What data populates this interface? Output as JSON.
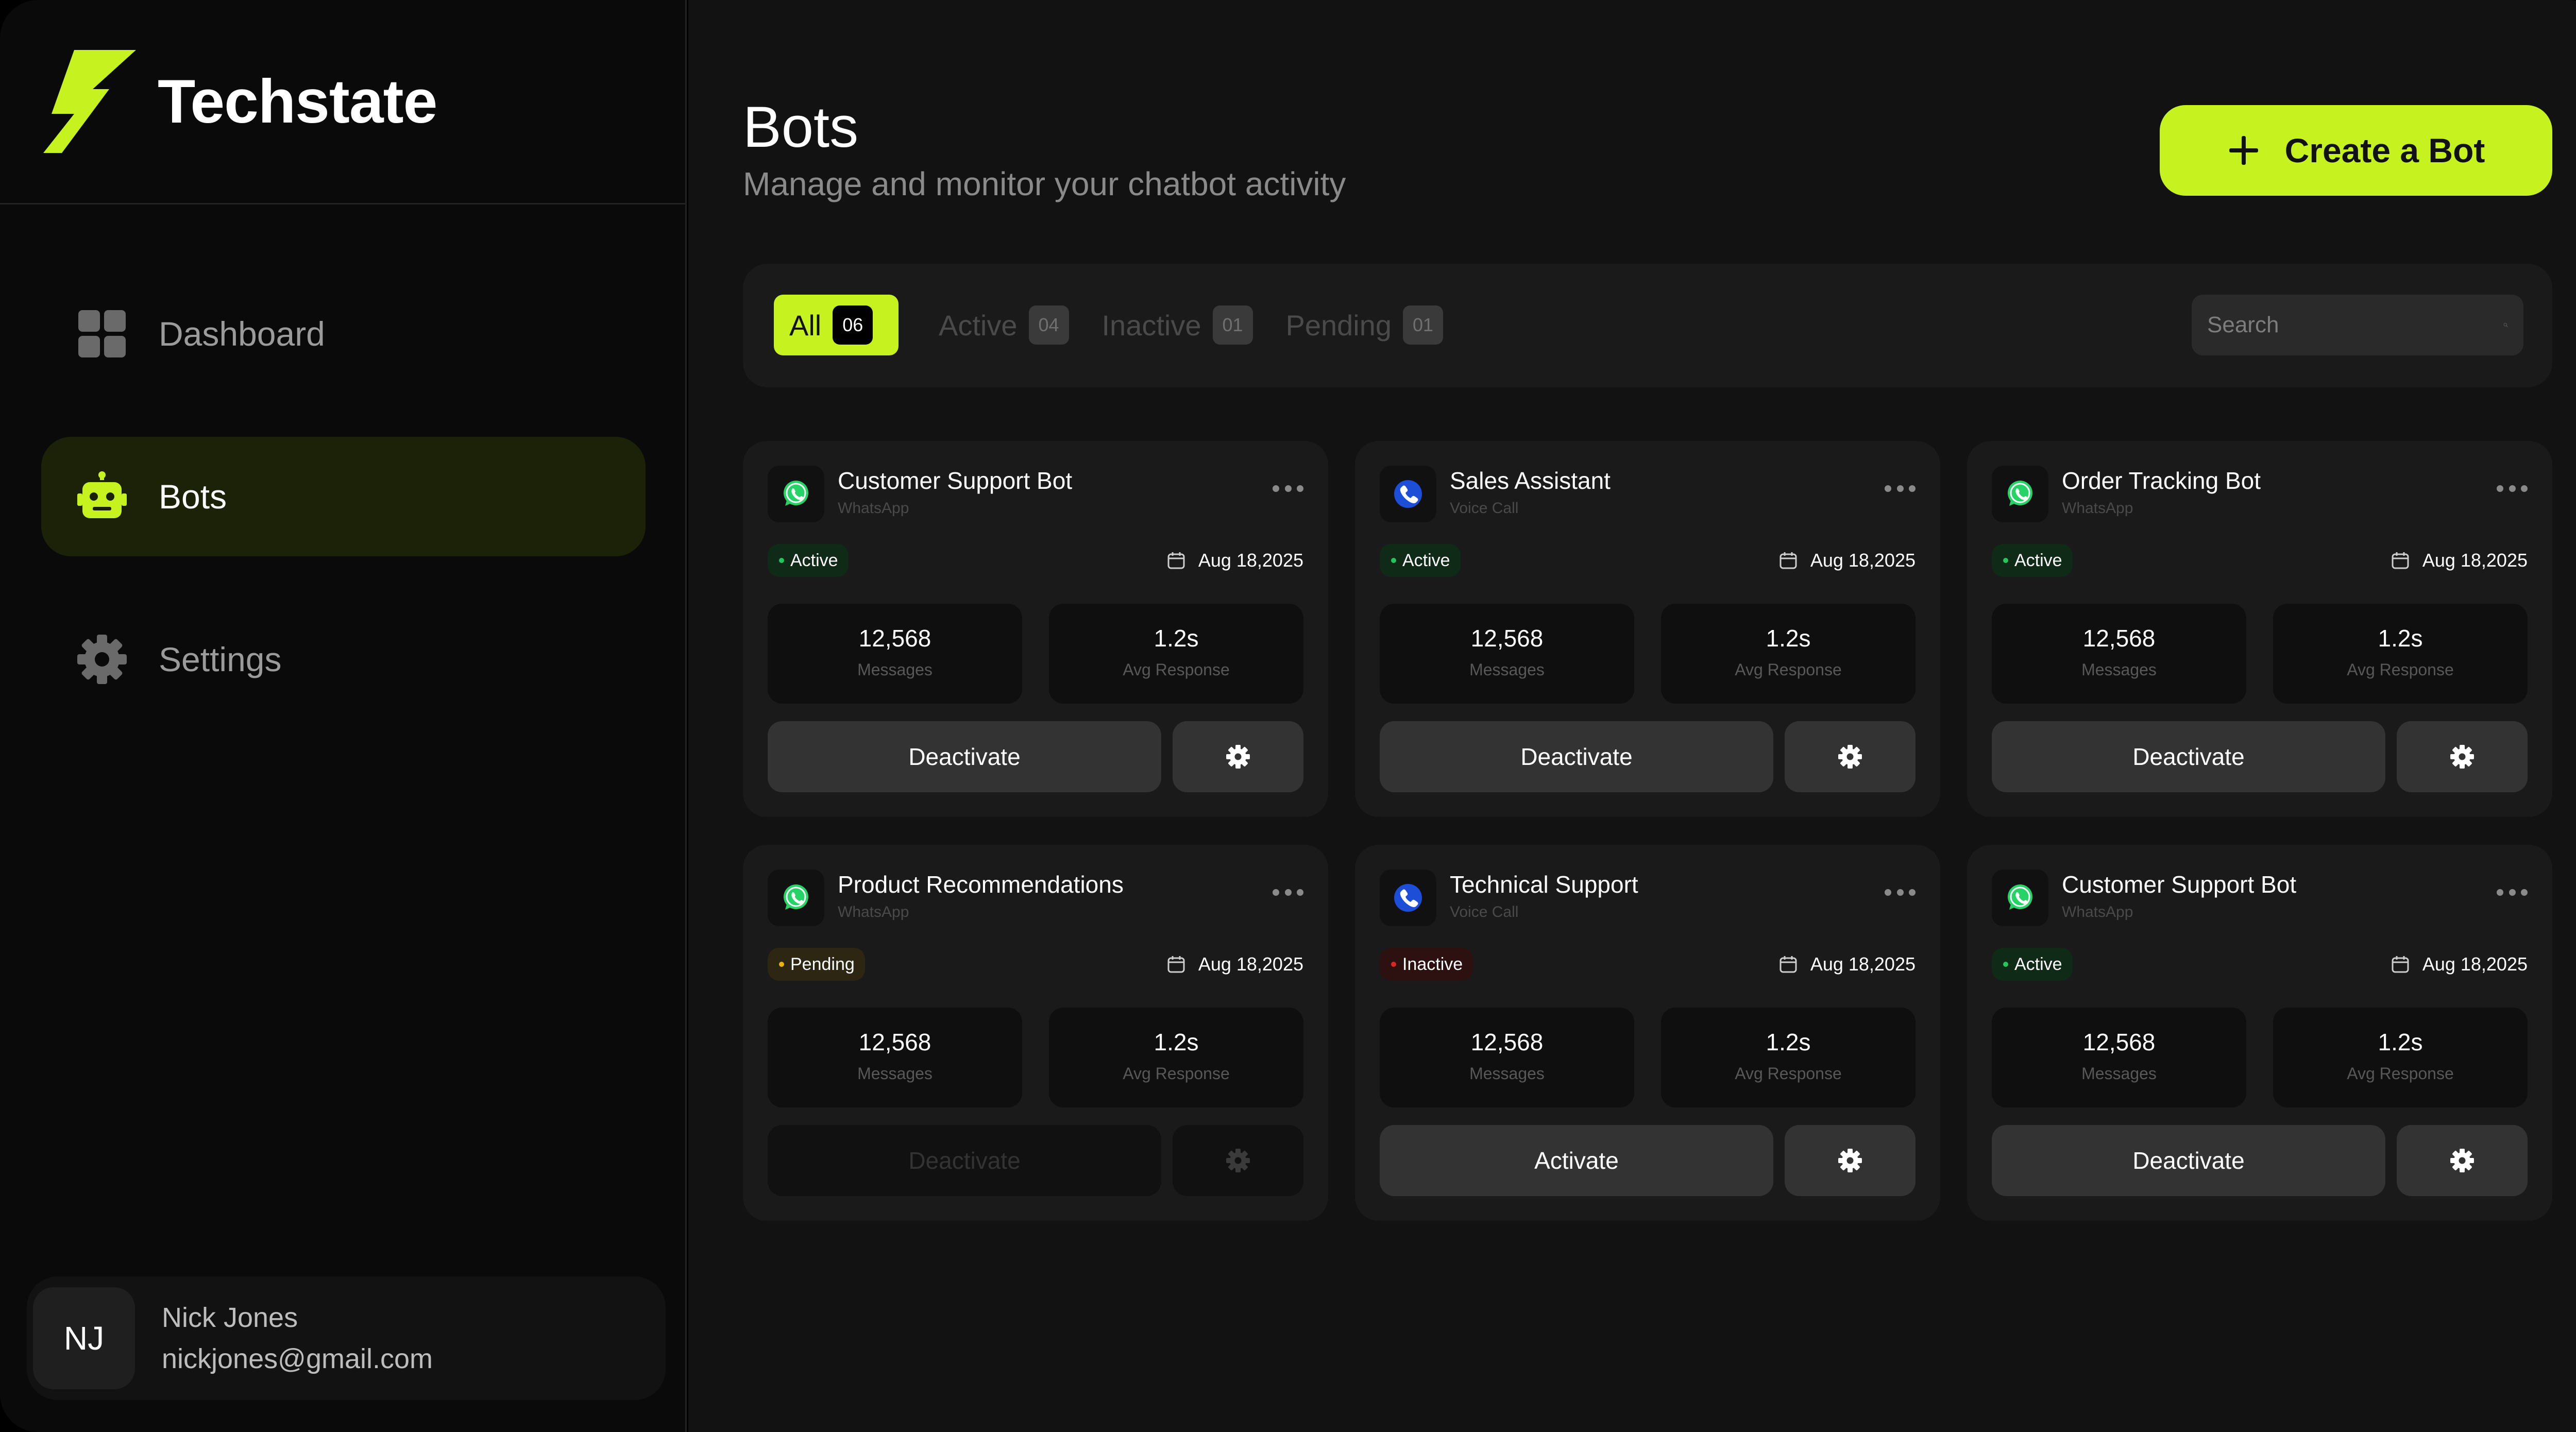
{
  "brand": {
    "name": "Techstate",
    "accent": "#c6f21f"
  },
  "sidebar": {
    "items": [
      {
        "label": "Dashboard",
        "icon": "dashboard-grid-icon",
        "active": false
      },
      {
        "label": "Bots",
        "icon": "robot-icon",
        "active": true
      },
      {
        "label": "Settings",
        "icon": "gear-icon",
        "active": false
      }
    ],
    "user": {
      "initials": "NJ",
      "name": "Nick Jones",
      "email": "nickjones@gmail.com"
    }
  },
  "header": {
    "title": "Bots",
    "subtitle": "Manage and monitor your chatbot activity",
    "create_button": "Create a Bot"
  },
  "filters": {
    "tabs": [
      {
        "label": "All",
        "count": "06",
        "active": true
      },
      {
        "label": "Active",
        "count": "04",
        "active": false
      },
      {
        "label": "Inactive",
        "count": "01",
        "active": false
      },
      {
        "label": "Pending",
        "count": "01",
        "active": false
      }
    ],
    "search_placeholder": "Search"
  },
  "bots": [
    {
      "name": "Customer Support Bot",
      "channel": "WhatsApp",
      "channel_icon": "whatsapp-icon",
      "status": "Active",
      "date": "Aug 18,2025",
      "messages": "12,568",
      "messages_label": "Messages",
      "avg_response": "1.2s",
      "avg_response_label": "Avg Response",
      "action": "Deactivate",
      "disabled": false
    },
    {
      "name": "Sales Assistant",
      "channel": "Voice Call",
      "channel_icon": "phone-icon",
      "status": "Active",
      "date": "Aug 18,2025",
      "messages": "12,568",
      "messages_label": "Messages",
      "avg_response": "1.2s",
      "avg_response_label": "Avg Response",
      "action": "Deactivate",
      "disabled": false
    },
    {
      "name": "Order Tracking Bot",
      "channel": "WhatsApp",
      "channel_icon": "whatsapp-icon",
      "status": "Active",
      "date": "Aug 18,2025",
      "messages": "12,568",
      "messages_label": "Messages",
      "avg_response": "1.2s",
      "avg_response_label": "Avg Response",
      "action": "Deactivate",
      "disabled": false
    },
    {
      "name": "Product Recommendations",
      "channel": "WhatsApp",
      "channel_icon": "whatsapp-icon",
      "status": "Pending",
      "date": "Aug 18,2025",
      "messages": "12,568",
      "messages_label": "Messages",
      "avg_response": "1.2s",
      "avg_response_label": "Avg Response",
      "action": "Deactivate",
      "disabled": true
    },
    {
      "name": "Technical Support",
      "channel": "Voice Call",
      "channel_icon": "phone-icon",
      "status": "Inactive",
      "date": "Aug 18,2025",
      "messages": "12,568",
      "messages_label": "Messages",
      "avg_response": "1.2s",
      "avg_response_label": "Avg Response",
      "action": "Activate",
      "disabled": false
    },
    {
      "name": "Customer Support Bot",
      "channel": "WhatsApp",
      "channel_icon": "whatsapp-icon",
      "status": "Active",
      "date": "Aug 18,2025",
      "messages": "12,568",
      "messages_label": "Messages",
      "avg_response": "1.2s",
      "avg_response_label": "Avg Response",
      "action": "Deactivate",
      "disabled": false
    }
  ],
  "colors": {
    "status_active": "#22c55e",
    "status_pending": "#eab308",
    "status_inactive": "#dc2626",
    "whatsapp": "#25d366",
    "voice_call": "#1d4ed8"
  }
}
